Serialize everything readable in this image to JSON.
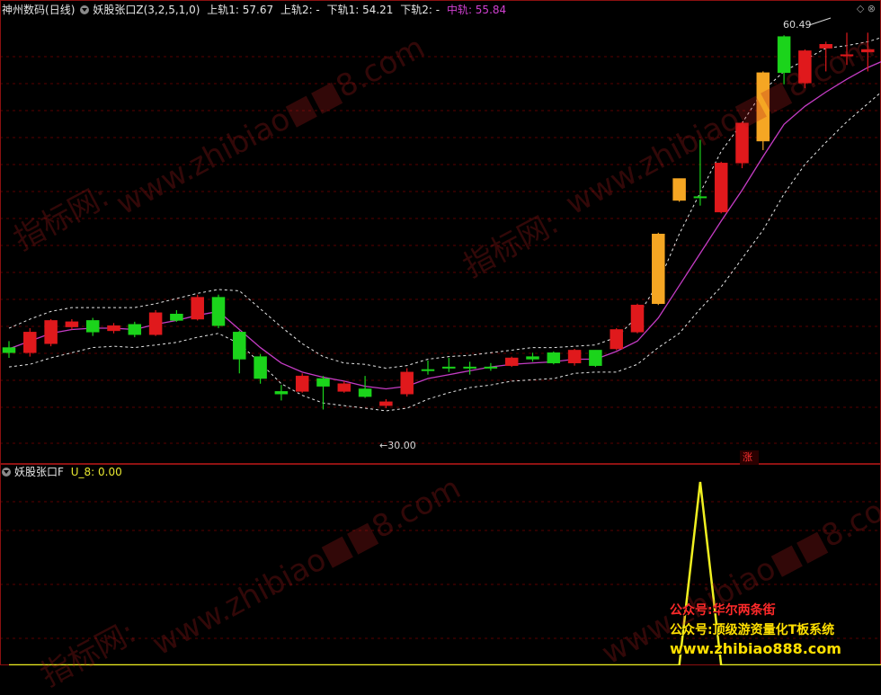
{
  "main_header": {
    "stock_name": "神州数码",
    "period": "(日线)",
    "indicator": "妖股张口Z(3,2,5,1,0)",
    "upper1": "上轨1: 57.67",
    "upper2": "上轨2: -",
    "lower1": "下轨1: 54.21",
    "lower2": "下轨2: -",
    "middle": "中轨: 55.84"
  },
  "sub_header": {
    "indicator": "妖股张口F",
    "value": "U_8: 0.00"
  },
  "annotations": {
    "high": "60.49",
    "low": "30.00",
    "rise_tag": "涨"
  },
  "promo": {
    "line1": "公众号:华尔两条街",
    "line2": "公众号:顶级游资量化T板系统",
    "line3": "www.zhibiao888.com"
  },
  "watermark": [
    "www.zhibiao■■8.com",
    "指标网:"
  ],
  "colors": {
    "up": "#e0191c",
    "down": "#1bd41b",
    "gold": "#f5a623",
    "middle_line": "#c43cc4",
    "band": "#e6e6e6",
    "u8": "#f0f020",
    "grid": "#5a0000"
  },
  "chart_data": [
    {
      "type": "candlestick",
      "title": "妖股张口Z(3,2,5,1,0)",
      "ylim": [
        28.5,
        62.5
      ],
      "candles": [
        {
          "o": 37.1,
          "c": 36.7,
          "h": 37.6,
          "l": 36.3,
          "color": "down"
        },
        {
          "o": 36.7,
          "c": 38.3,
          "h": 38.6,
          "l": 36.4,
          "color": "up"
        },
        {
          "o": 37.4,
          "c": 39.2,
          "h": 39.3,
          "l": 37.2,
          "color": "up"
        },
        {
          "o": 38.7,
          "c": 39.1,
          "h": 39.3,
          "l": 38.5,
          "color": "up"
        },
        {
          "o": 39.2,
          "c": 38.3,
          "h": 39.4,
          "l": 38.0,
          "color": "down"
        },
        {
          "o": 38.4,
          "c": 38.8,
          "h": 39.0,
          "l": 38.2,
          "color": "up"
        },
        {
          "o": 38.9,
          "c": 38.1,
          "h": 39.1,
          "l": 37.9,
          "color": "down"
        },
        {
          "o": 38.1,
          "c": 39.8,
          "h": 40.0,
          "l": 38.0,
          "color": "up"
        },
        {
          "o": 39.7,
          "c": 39.2,
          "h": 40.0,
          "l": 39.1,
          "color": "down"
        },
        {
          "o": 39.3,
          "c": 41.0,
          "h": 41.2,
          "l": 39.2,
          "color": "up"
        },
        {
          "o": 41.0,
          "c": 38.8,
          "h": 41.2,
          "l": 38.6,
          "color": "down"
        },
        {
          "o": 38.3,
          "c": 36.2,
          "h": 38.4,
          "l": 35.1,
          "color": "down"
        },
        {
          "o": 36.4,
          "c": 34.7,
          "h": 36.6,
          "l": 34.3,
          "color": "down"
        },
        {
          "o": 33.7,
          "c": 33.5,
          "h": 34.2,
          "l": 33.0,
          "color": "down"
        },
        {
          "o": 33.7,
          "c": 34.9,
          "h": 35.1,
          "l": 33.6,
          "color": "up"
        },
        {
          "o": 34.7,
          "c": 34.1,
          "h": 34.9,
          "l": 32.3,
          "color": "down"
        },
        {
          "o": 33.7,
          "c": 34.3,
          "h": 34.5,
          "l": 33.6,
          "color": "up"
        },
        {
          "o": 33.9,
          "c": 33.3,
          "h": 34.9,
          "l": 33.2,
          "color": "down"
        },
        {
          "o": 32.6,
          "c": 32.9,
          "h": 33.1,
          "l": 32.4,
          "color": "up"
        },
        {
          "o": 33.5,
          "c": 35.2,
          "h": 35.5,
          "l": 33.3,
          "color": "up"
        },
        {
          "o": 35.3,
          "c": 35.4,
          "h": 36.1,
          "l": 35.0,
          "color": "down"
        },
        {
          "o": 35.5,
          "c": 35.6,
          "h": 36.3,
          "l": 35.2,
          "color": "down"
        },
        {
          "o": 35.6,
          "c": 35.6,
          "h": 36.0,
          "l": 35.0,
          "color": "down"
        },
        {
          "o": 35.6,
          "c": 35.6,
          "h": 35.9,
          "l": 35.3,
          "color": "down"
        },
        {
          "o": 35.7,
          "c": 36.3,
          "h": 36.4,
          "l": 35.6,
          "color": "up"
        },
        {
          "o": 36.2,
          "c": 36.4,
          "h": 36.7,
          "l": 36.0,
          "color": "down"
        },
        {
          "o": 36.7,
          "c": 35.9,
          "h": 36.8,
          "l": 35.8,
          "color": "down"
        },
        {
          "o": 35.9,
          "c": 36.9,
          "h": 37.0,
          "l": 35.7,
          "color": "up"
        },
        {
          "o": 36.9,
          "c": 35.7,
          "h": 36.9,
          "l": 35.6,
          "color": "down"
        },
        {
          "o": 37.0,
          "c": 38.5,
          "h": 38.6,
          "l": 36.9,
          "color": "up"
        },
        {
          "o": 38.3,
          "c": 40.4,
          "h": 40.5,
          "l": 38.2,
          "color": "up"
        },
        {
          "o": 40.5,
          "c": 45.9,
          "h": 46.0,
          "l": 40.4,
          "color": "gold"
        },
        {
          "o": 48.5,
          "c": 50.2,
          "h": 50.2,
          "l": 48.4,
          "color": "gold"
        },
        {
          "o": 48.8,
          "c": 48.7,
          "h": 53.2,
          "l": 48.1,
          "color": "down"
        },
        {
          "o": 47.6,
          "c": 51.4,
          "h": 51.5,
          "l": 47.5,
          "color": "up"
        },
        {
          "o": 51.4,
          "c": 54.5,
          "h": 54.6,
          "l": 51.0,
          "color": "up"
        },
        {
          "o": 53.1,
          "c": 58.4,
          "h": 58.5,
          "l": 52.4,
          "color": "gold"
        },
        {
          "o": 58.4,
          "c": 61.2,
          "h": 61.3,
          "l": 57.5,
          "color": "down"
        },
        {
          "o": 57.6,
          "c": 60.1,
          "h": 60.2,
          "l": 57.2,
          "color": "up"
        },
        {
          "o": 60.3,
          "c": 60.6,
          "h": 60.8,
          "l": 58.5,
          "color": "up"
        },
        {
          "o": 59.8,
          "c": 59.7,
          "h": 61.5,
          "l": 59.0,
          "color": "up"
        },
        {
          "o": 60.0,
          "c": 60.2,
          "h": 61.5,
          "l": 58.5,
          "color": "up"
        },
        {
          "o": 59.6,
          "c": 61.0,
          "h": 61.2,
          "l": 58.8,
          "color": "up"
        }
      ],
      "middle_line": [
        37.0,
        37.6,
        38.2,
        38.5,
        38.6,
        38.6,
        38.5,
        38.9,
        39.2,
        39.6,
        39.9,
        38.5,
        37.1,
        35.9,
        35.2,
        34.8,
        34.5,
        34.1,
        33.9,
        34.1,
        34.7,
        35.0,
        35.3,
        35.6,
        35.8,
        35.9,
        36.0,
        36.2,
        36.2,
        36.8,
        37.6,
        39.4,
        41.9,
        44.4,
        46.9,
        49.3,
        51.9,
        54.4,
        55.8,
        56.9,
        57.9,
        58.8,
        59.5
      ],
      "upper_band": [
        38.6,
        39.3,
        39.9,
        40.2,
        40.2,
        40.2,
        40.2,
        40.5,
        40.9,
        41.3,
        41.6,
        41.5,
        40.1,
        38.7,
        37.4,
        36.4,
        35.9,
        35.8,
        35.5,
        35.7,
        36.2,
        36.4,
        36.5,
        36.7,
        36.9,
        37.1,
        37.1,
        37.2,
        37.3,
        37.9,
        39.5,
        42.1,
        45.9,
        49.1,
        52.3,
        54.5,
        57.0,
        58.5,
        59.4,
        60.3,
        60.5,
        60.8,
        61.3
      ],
      "lower_band": [
        35.6,
        35.8,
        36.3,
        36.7,
        37.1,
        37.2,
        37.1,
        37.3,
        37.5,
        37.9,
        38.2,
        37.4,
        35.9,
        34.3,
        33.4,
        32.8,
        32.6,
        32.4,
        32.2,
        32.4,
        33.1,
        33.6,
        34.0,
        34.2,
        34.5,
        34.6,
        34.7,
        35.1,
        35.2,
        35.2,
        35.8,
        37.1,
        38.2,
        40.1,
        41.8,
        44.0,
        46.2,
        49.0,
        51.3,
        53.0,
        54.6,
        56.0,
        57.4
      ]
    },
    {
      "type": "line",
      "title": "妖股张口F",
      "series": [
        {
          "name": "U_8",
          "values": [
            0,
            0,
            0,
            0,
            0,
            0,
            0,
            0,
            0,
            0,
            0,
            0,
            0,
            0,
            0,
            0,
            0,
            0,
            0,
            0,
            0,
            0,
            0,
            0,
            0,
            0,
            0,
            0,
            0,
            0,
            0,
            0,
            0,
            8,
            0,
            0,
            0,
            0,
            0,
            0,
            0,
            0,
            0
          ]
        }
      ],
      "ylim": [
        0,
        8
      ]
    }
  ]
}
